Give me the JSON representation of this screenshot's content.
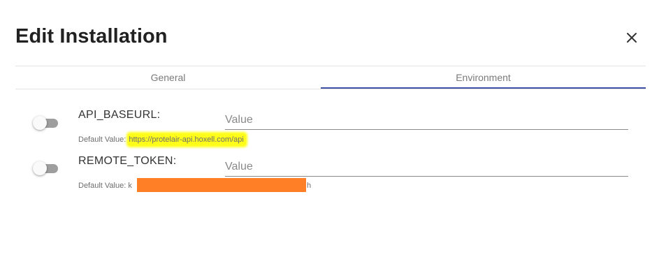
{
  "dialog": {
    "title": "Edit Installation",
    "close_icon": "close-icon"
  },
  "tabs": [
    {
      "label": "General",
      "active": false
    },
    {
      "label": "Environment",
      "active": true
    }
  ],
  "colors": {
    "accent": "#3f51a5",
    "highlight": "#ffff1a",
    "redaction": "#ff7f27"
  },
  "env_vars": [
    {
      "name": "API_BASEURL:",
      "value": "",
      "placeholder": "Value",
      "enabled": false,
      "default_label": "Default Value:",
      "default_value": "https://protelair-api.hoxell.com/api"
    },
    {
      "name": "REMOTE_TOKEN:",
      "value": "",
      "placeholder": "Value",
      "enabled": false,
      "default_label": "Default Value:",
      "default_value_start": "k",
      "default_value_end": "h"
    }
  ]
}
